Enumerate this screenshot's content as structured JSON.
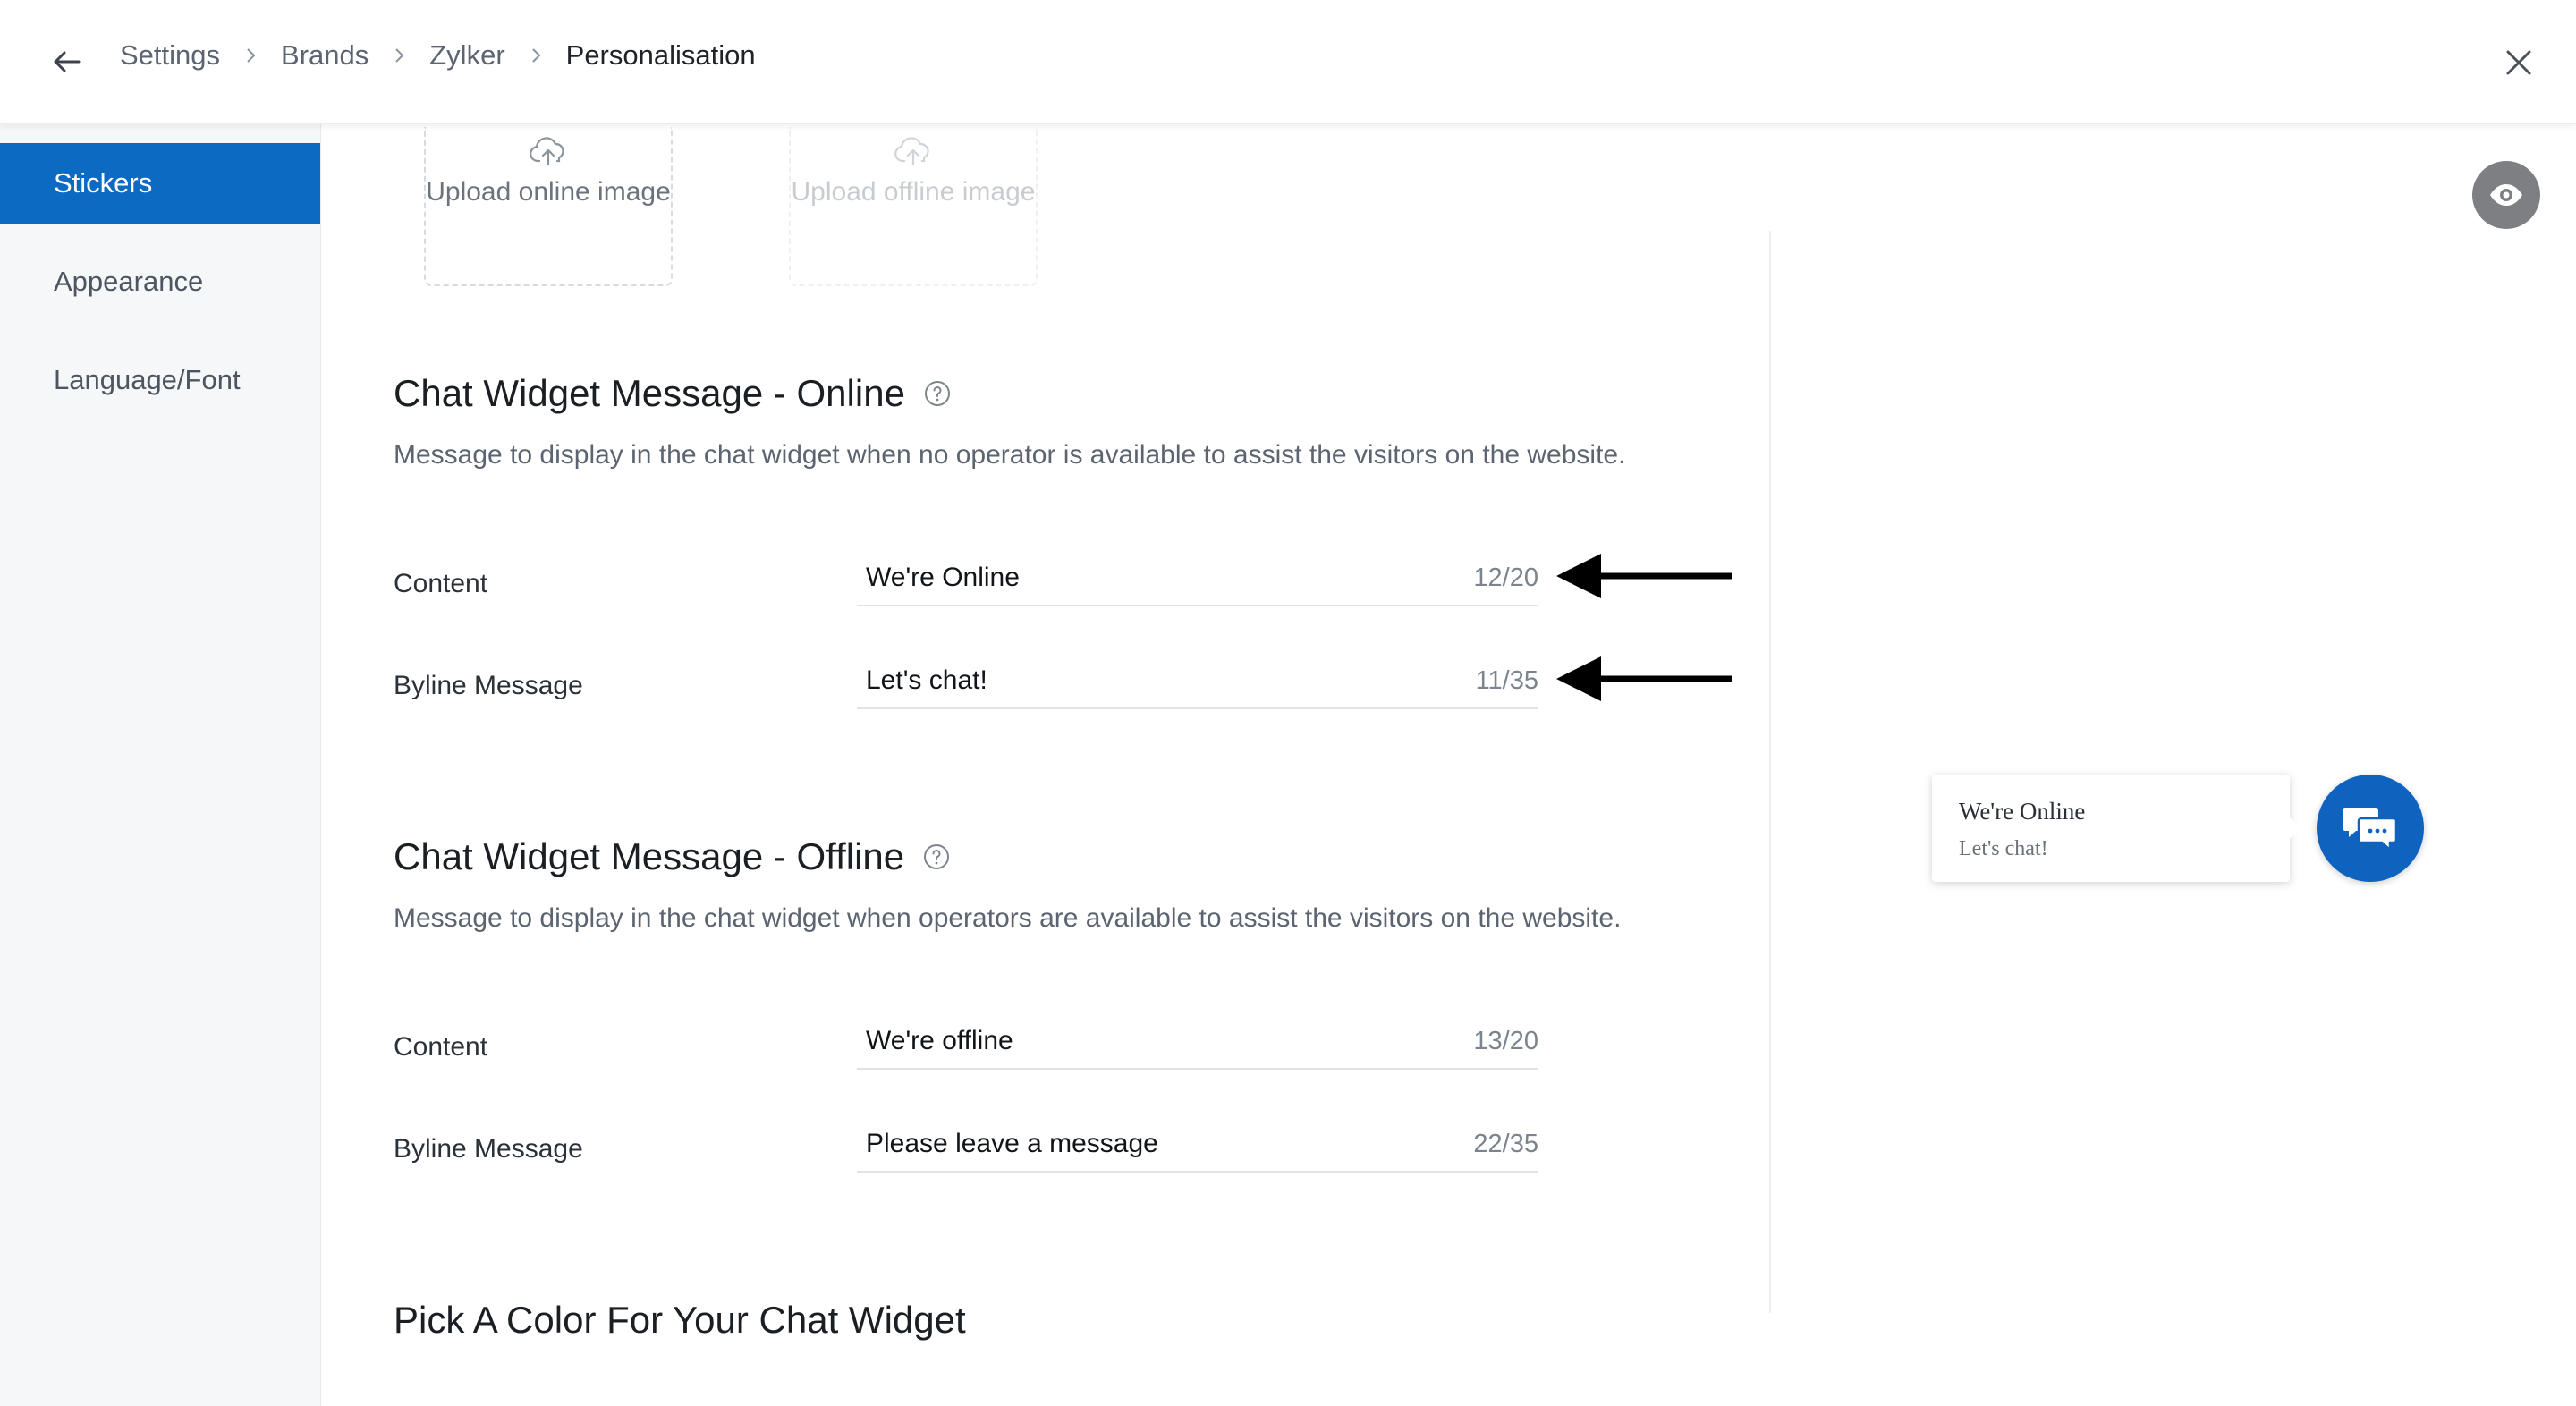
{
  "header": {
    "breadcrumbs": [
      "Settings",
      "Brands",
      "Zylker"
    ],
    "current": "Personalisation"
  },
  "sidebar": {
    "items": [
      {
        "label": "Stickers",
        "active": true
      },
      {
        "label": "Appearance",
        "active": false
      },
      {
        "label": "Language/Font",
        "active": false
      }
    ]
  },
  "uploads": {
    "online_label": "Upload online image",
    "offline_label": "Upload offline image",
    "offline_disabled": true
  },
  "online": {
    "title": "Chat Widget Message - Online",
    "description": "Message to display in the chat widget when no operator is available to assist the visitors on the website.",
    "content_label": "Content",
    "content_value": "We're Online",
    "content_counter": "12/20",
    "byline_label": "Byline Message",
    "byline_value": "Let's chat!",
    "byline_counter": "11/35"
  },
  "offline": {
    "title": "Chat Widget Message - Offline",
    "description": "Message to display in the chat widget when operators are available to assist the visitors on the website.",
    "content_label": "Content",
    "content_value": "We're offline",
    "content_counter": "13/20",
    "byline_label": "Byline Message",
    "byline_value": "Please leave a message",
    "byline_counter": "22/35"
  },
  "color_section": {
    "title": "Pick A Color For Your Chat Widget"
  },
  "preview": {
    "sticker_title": "We're Online",
    "sticker_subtitle": "Let's chat!"
  },
  "icons": {
    "back": "arrow-left-icon",
    "close": "close-icon",
    "help": "question-circle-icon",
    "upload": "cloud-upload-icon",
    "preview": "eye-icon",
    "chat": "chat-bubbles-icon",
    "annotation": "arrow-left-annotation"
  },
  "colors": {
    "accent": "#0c6ac2",
    "chat_button": "#0e63bf",
    "preview_button": "#7d7f82"
  }
}
